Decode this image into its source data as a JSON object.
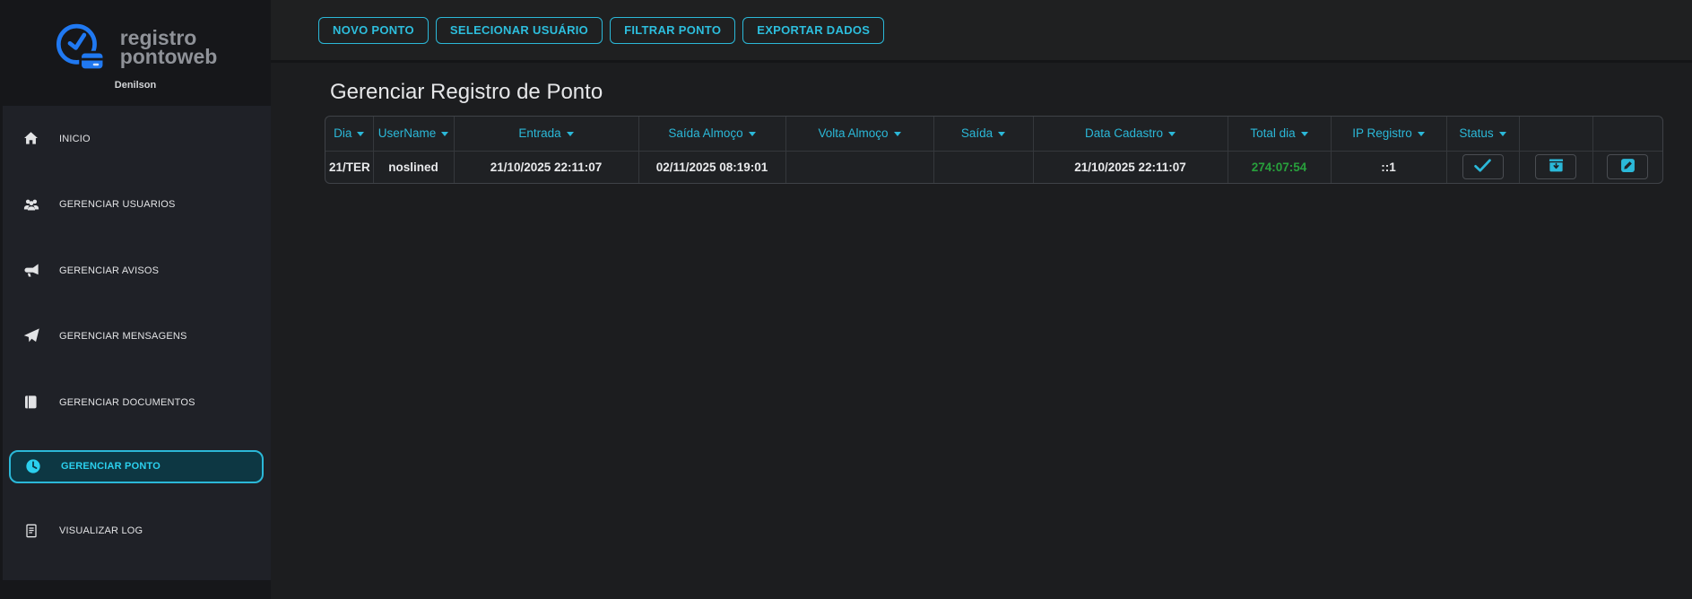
{
  "app": {
    "logo_line1": "registro",
    "logo_line2": "pontoweb",
    "user": "Denilson"
  },
  "colors": {
    "accent_cyan": "#2bb8d8",
    "success_green": "#28a03c",
    "logo_blue": "#2079f2",
    "sidebar_bg": "#1f2127",
    "panel_dark": "#16171a"
  },
  "sidebar": {
    "items": [
      {
        "label": "INICIO",
        "icon": "home-icon",
        "active": false
      },
      {
        "label": "GERENCIAR USUARIOS",
        "icon": "users-icon",
        "active": false
      },
      {
        "label": "GERENCIAR AVISOS",
        "icon": "megaphone-icon",
        "active": false
      },
      {
        "label": "GERENCIAR MENSAGENS",
        "icon": "paper-plane-icon",
        "active": false
      },
      {
        "label": "GERENCIAR DOCUMENTOS",
        "icon": "book-icon",
        "active": false
      },
      {
        "label": "GERENCIAR PONTO",
        "icon": "clock-icon",
        "active": true
      },
      {
        "label": "VISUALIZAR LOG",
        "icon": "file-text-icon",
        "active": false
      }
    ]
  },
  "toolbar": {
    "buttons": [
      "NOVO PONTO",
      "SELECIONAR USUÁRIO",
      "FILTRAR PONTO",
      "EXPORTAR DADOS"
    ]
  },
  "main": {
    "title": "Gerenciar Registro de Ponto"
  },
  "table": {
    "columns": [
      "Dia",
      "UserName",
      "Entrada",
      "Saída Almoço",
      "Volta Almoço",
      "Saída",
      "Data Cadastro",
      "Total dia",
      "IP Registro",
      "Status"
    ],
    "rows": [
      {
        "dia": "21/TER",
        "username": "noslined",
        "entrada": "21/10/2025 22:11:07",
        "saida_almoco": "02/11/2025 08:19:01",
        "volta_almoco": "",
        "saida": "",
        "data_cadastro": "21/10/2025 22:11:07",
        "total_dia": "274:07:54",
        "ip_registro": "::1"
      }
    ]
  }
}
